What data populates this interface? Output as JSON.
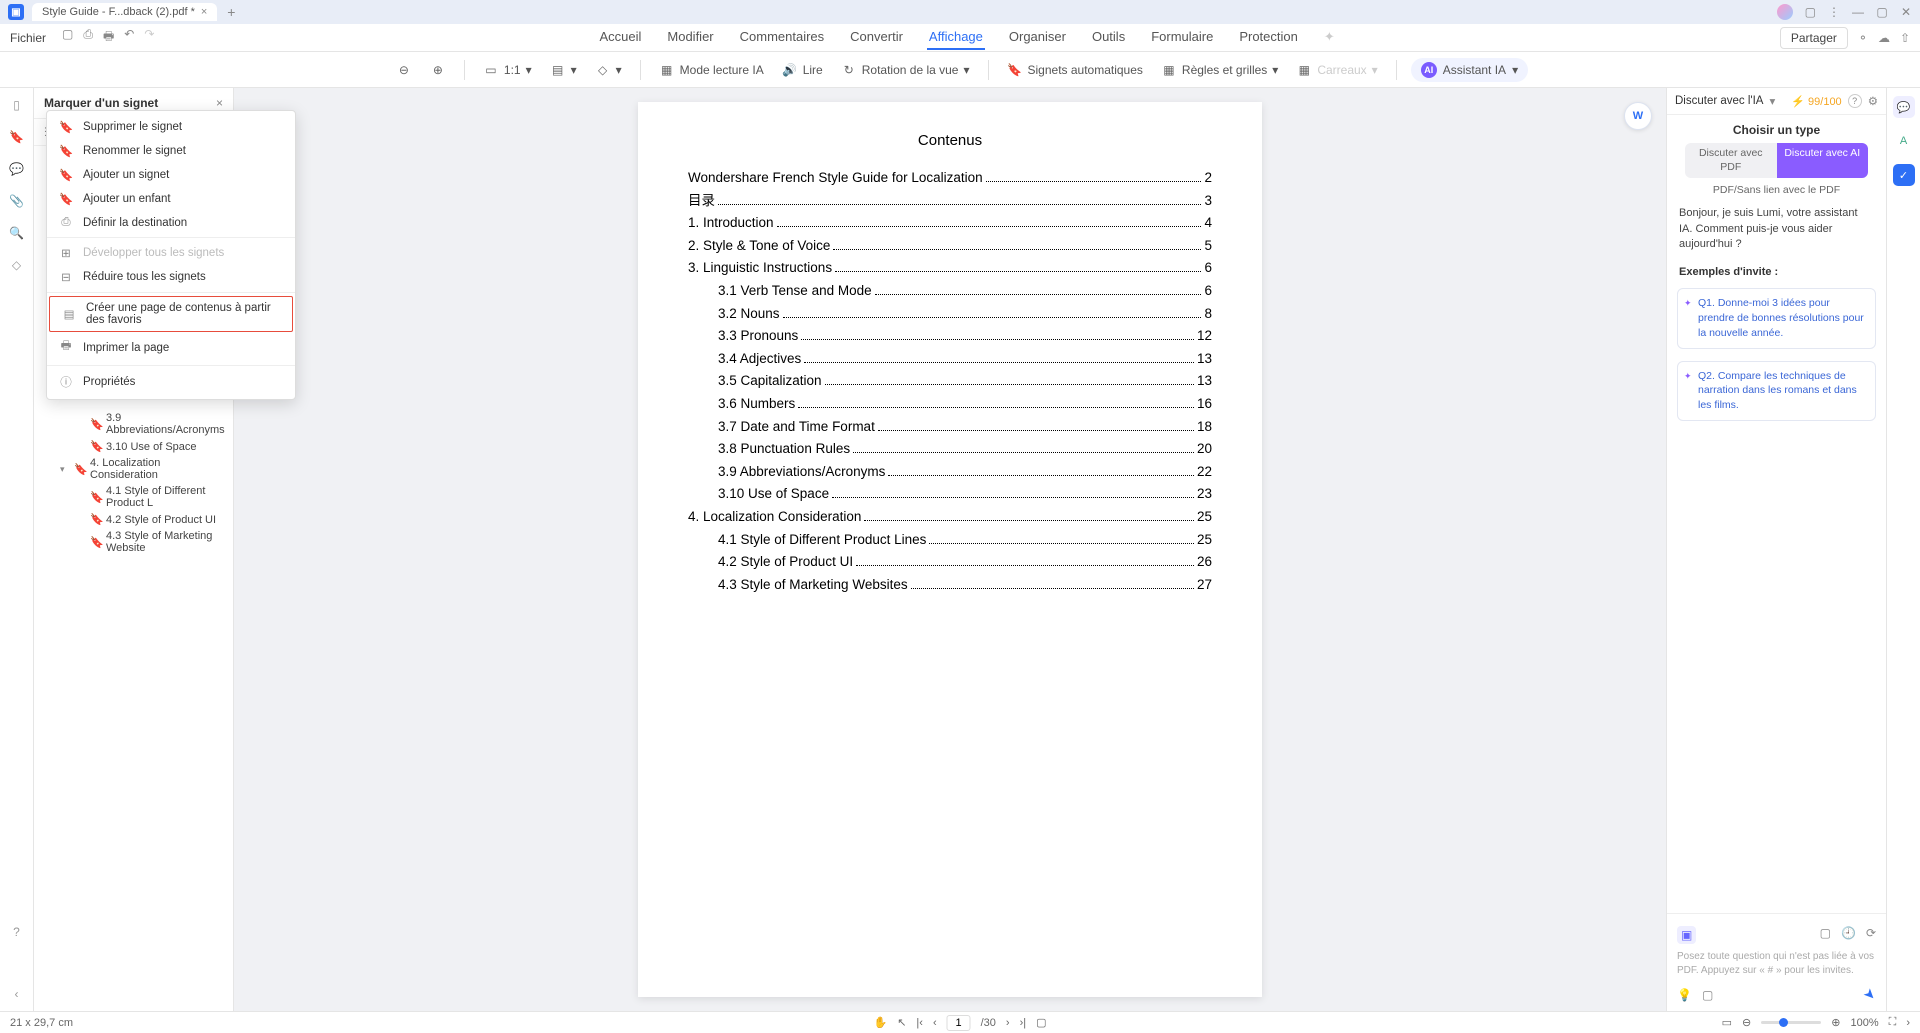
{
  "titlebar": {
    "tab_label": "Style Guide - F...dback (2).pdf *"
  },
  "menubar": {
    "file": "Fichier",
    "tabs": {
      "accueil": "Accueil",
      "modifier": "Modifier",
      "commentaires": "Commentaires",
      "convertir": "Convertir",
      "affichage": "Affichage",
      "organiser": "Organiser",
      "outils": "Outils",
      "formulaire": "Formulaire",
      "protection": "Protection"
    },
    "share": "Partager"
  },
  "toolbar": {
    "fit": "1:1",
    "mode_lecture": "Mode lecture IA",
    "lire": "Lire",
    "rotation": "Rotation de la vue",
    "signets": "Signets automatiques",
    "regles": "Règles et grilles",
    "carreaux": "Carreaux",
    "assistant": "Assistant IA"
  },
  "bookmark_panel": {
    "title": "Marquer d'un signet"
  },
  "context_menu": {
    "supprimer": "Supprimer le signet",
    "renommer": "Renommer le signet",
    "ajouter": "Ajouter un signet",
    "ajouter_enfant": "Ajouter un enfant",
    "definir": "Définir la destination",
    "developper": "Développer tous les signets",
    "reduire": "Réduire tous les signets",
    "creer_page": "Créer une page de contenus à partir des favoris",
    "imprimer": "Imprimer la page",
    "proprietes": "Propriétés"
  },
  "visible_bookmarks": [
    {
      "level": 2,
      "label": "3.9 Abbreviations/Acronyms"
    },
    {
      "level": 2,
      "label": "3.10 Use of Space"
    },
    {
      "level": 1,
      "label": "4. Localization Consideration",
      "caret": "▾"
    },
    {
      "level": 2,
      "label": "4.1 Style of Different Product L"
    },
    {
      "level": 2,
      "label": "4.2 Style of Product UI"
    },
    {
      "level": 2,
      "label": "4.3 Style of Marketing Website"
    }
  ],
  "document": {
    "title": "Contenus",
    "toc": [
      {
        "level": 1,
        "text": "Wondershare French Style Guide for Localization",
        "page": "2"
      },
      {
        "level": 1,
        "text": "目录",
        "page": "3"
      },
      {
        "level": 1,
        "text": "1. Introduction",
        "page": "4"
      },
      {
        "level": 1,
        "text": "2. Style & Tone of Voice",
        "page": "5"
      },
      {
        "level": 1,
        "text": "3. Linguistic Instructions",
        "page": "6"
      },
      {
        "level": 2,
        "text": "3.1 Verb Tense and Mode",
        "page": "6"
      },
      {
        "level": 2,
        "text": "3.2 Nouns",
        "page": "8"
      },
      {
        "level": 2,
        "text": "3.3 Pronouns",
        "page": "12"
      },
      {
        "level": 2,
        "text": "3.4 Adjectives",
        "page": "13"
      },
      {
        "level": 2,
        "text": "3.5 Capitalization",
        "page": "13"
      },
      {
        "level": 2,
        "text": "3.6 Numbers",
        "page": "16"
      },
      {
        "level": 2,
        "text": "3.7 Date and Time Format",
        "page": "18"
      },
      {
        "level": 2,
        "text": "3.8 Punctuation Rules",
        "page": "20"
      },
      {
        "level": 2,
        "text": "3.9 Abbreviations/Acronyms",
        "page": "22"
      },
      {
        "level": 2,
        "text": "3.10 Use of Space",
        "page": "23"
      },
      {
        "level": 1,
        "text": "4. Localization Consideration",
        "page": "25"
      },
      {
        "level": 2,
        "text": "4.1 Style of Different Product Lines",
        "page": "25"
      },
      {
        "level": 2,
        "text": "4.2 Style of Product UI",
        "page": "26"
      },
      {
        "level": 2,
        "text": "4.3 Style of Marketing Websites",
        "page": "27"
      }
    ]
  },
  "ai_panel": {
    "header": "Discuter avec l'IA",
    "credits": "99/100",
    "choose": "Choisir un type",
    "toggle_pdf": "Discuter avec PDF",
    "toggle_ai": "Discuter avec AI",
    "sub": "PDF/Sans lien avec le PDF",
    "greeting": "Bonjour, je suis Lumi, votre assistant IA. Comment puis-je vous aider aujourd'hui ?",
    "examples_title": "Exemples d'invite :",
    "prompt1": "Q1. Donne-moi 3 idées pour prendre de bonnes résolutions pour la nouvelle année.",
    "prompt2": "Q2. Compare les techniques de narration dans les romans et dans les films.",
    "hint": "Posez toute question qui n'est pas liée à vos PDF. Appuyez sur « # » pour les invites."
  },
  "statusbar": {
    "dims": "21 x 29,7 cm",
    "page_current": "1",
    "page_total": "/30",
    "zoom": "100%"
  }
}
